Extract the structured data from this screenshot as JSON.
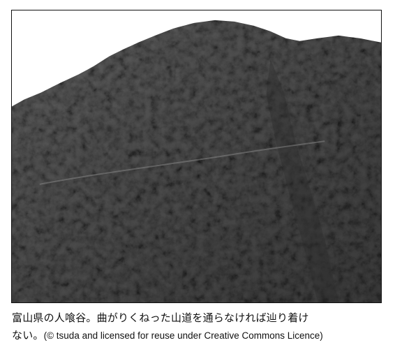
{
  "photo": {
    "alt": "mountain-photo",
    "sky_color": "#ffffff",
    "forest_color": "#4a4a4a"
  },
  "caption": {
    "line1": "富山県の人喰谷。曲がりくねった山道を通らなければ辿り着け",
    "line2_main": "ない。",
    "line2_credit": "(© tsuda and licensed for reuse under Creative Commons Licence)"
  }
}
